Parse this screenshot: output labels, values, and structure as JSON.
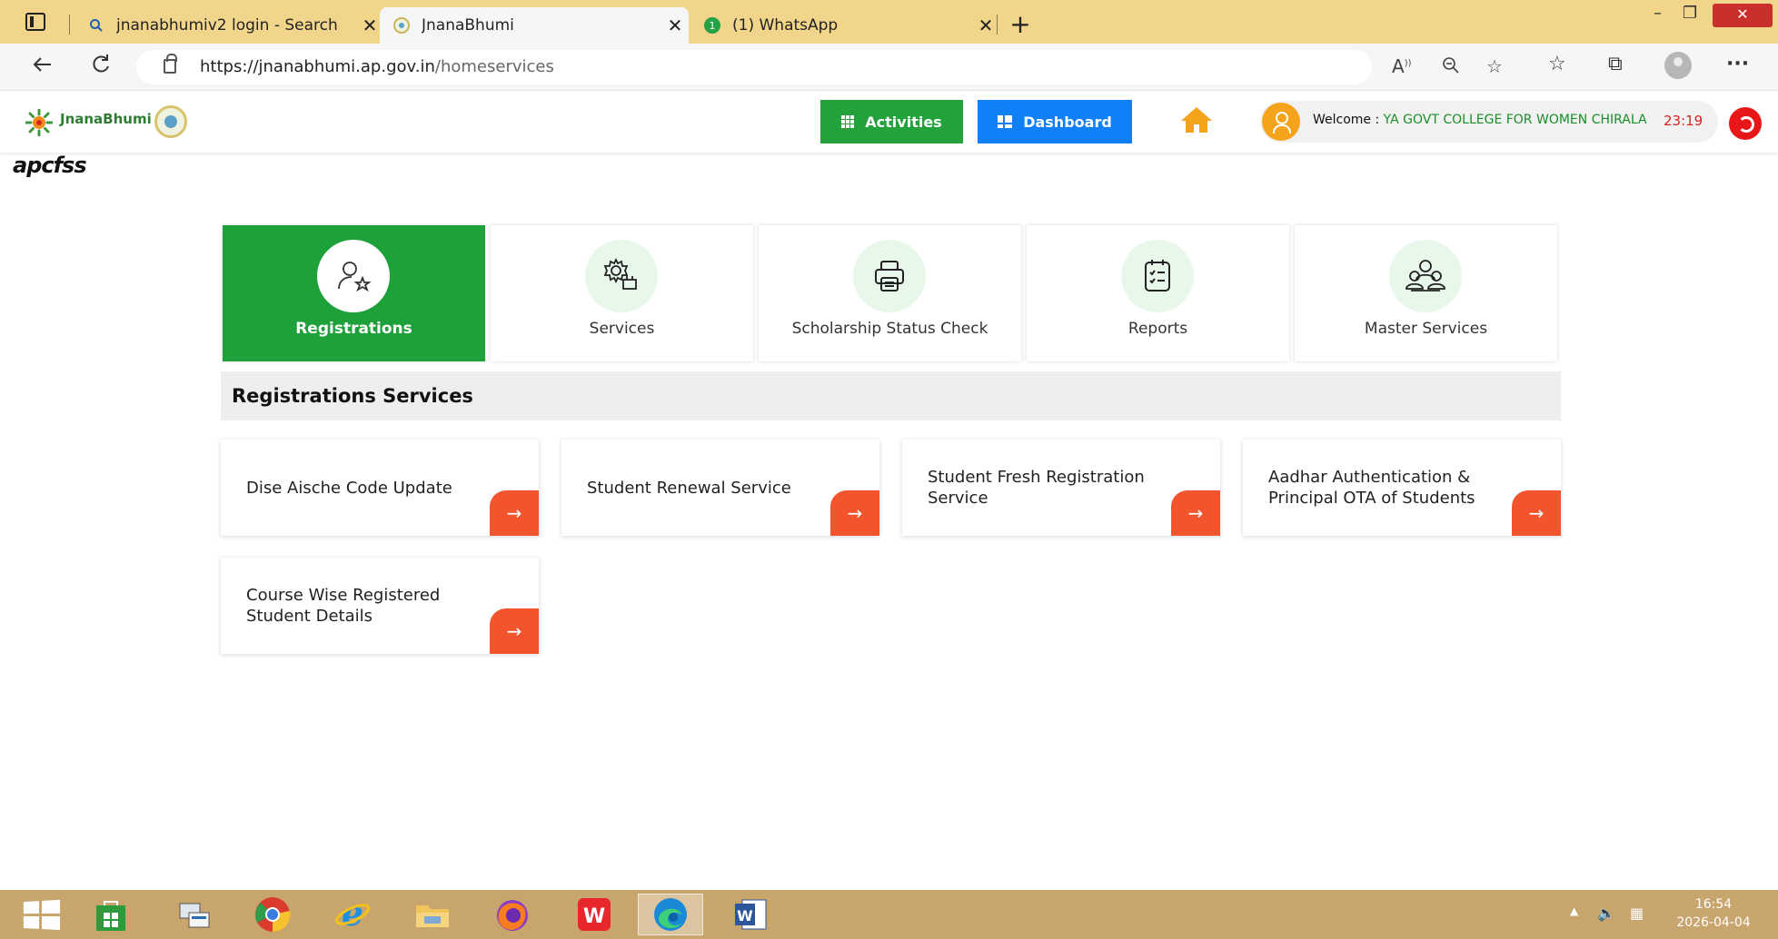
{
  "browser": {
    "tabs": [
      {
        "label": "jnanabhumiv2 login - Search",
        "icon": "search-icon"
      },
      {
        "label": "JnanaBhumi",
        "icon": "jnanabhumi-favicon"
      },
      {
        "label": "(1) WhatsApp",
        "icon": "whatsapp-icon",
        "badge": "1"
      }
    ],
    "close_glyph": "✕",
    "new_tab_glyph": "+",
    "url_host": "https://jnanabhumi.ap.gov.in",
    "url_path": "/homeservices",
    "window_close": "✕"
  },
  "header": {
    "logo_text": "JnanaBhumi",
    "activities_label": "Activities",
    "dashboard_label": "Dashboard",
    "welcome_prefix": "Welcome : ",
    "college_name": "YA GOVT COLLEGE FOR WOMEN CHIRALA",
    "session_timer": "23:19",
    "brand": "apcfss",
    "colors": {
      "activities": "#23a23b",
      "dashboard": "#1180f6",
      "home": "#f5a31a",
      "logout": "#e81616",
      "timer": "#d9241f"
    }
  },
  "cards": [
    {
      "label": "Registrations",
      "icon": "user-star-icon",
      "active": true
    },
    {
      "label": "Services",
      "icon": "gear-services-icon",
      "active": false
    },
    {
      "label": "Scholarship Status Check",
      "icon": "printer-icon",
      "active": false
    },
    {
      "label": "Reports",
      "icon": "clipboard-checklist-icon",
      "active": false
    },
    {
      "label": "Master Services",
      "icon": "user-group-icon",
      "active": false
    }
  ],
  "section": {
    "title": "Registrations Services"
  },
  "tiles": [
    {
      "line1": "Dise Aische Code Update",
      "line2": ""
    },
    {
      "line1": "Student Renewal Service",
      "line2": ""
    },
    {
      "line1": "Student Fresh Registration",
      "line2": "Service"
    },
    {
      "line1": "Aadhar Authentication &",
      "line2": "Principal OTA of Students"
    },
    {
      "line1": "Course Wise Registered",
      "line2": "Student Details"
    }
  ],
  "tile_arrow": "→",
  "taskbar": {
    "apps": [
      "store-icon",
      "file-manager-icon",
      "chrome-icon",
      "internet-explorer-icon",
      "folder-icon",
      "firefox-icon",
      "wps-office-icon",
      "edge-icon",
      "word-icon"
    ],
    "active_app": "edge-icon",
    "time": "16:54",
    "date": "2026-04-04"
  }
}
